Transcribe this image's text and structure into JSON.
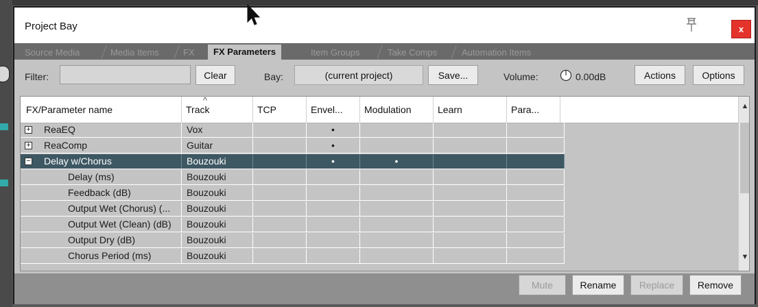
{
  "window": {
    "title": "Project Bay",
    "close_label": "x"
  },
  "tabs": [
    {
      "label": "Source Media",
      "active": false
    },
    {
      "label": "Media Items",
      "active": false
    },
    {
      "label": "FX",
      "active": false
    },
    {
      "label": "FX Parameters",
      "active": true
    },
    {
      "label": "Item Groups",
      "active": false
    },
    {
      "label": "Take Comps",
      "active": false
    },
    {
      "label": "Automation Items",
      "active": false
    }
  ],
  "toolbar": {
    "filter_label": "Filter:",
    "filter_value": "",
    "clear_label": "Clear",
    "bay_label": "Bay:",
    "bay_value": "(current project)",
    "save_label": "Save...",
    "volume_label": "Volume:",
    "volume_value": "0.00dB",
    "actions_label": "Actions",
    "options_label": "Options"
  },
  "table": {
    "columns": [
      "FX/Parameter name",
      "Track",
      "TCP",
      "Envel...",
      "Modulation",
      "Learn",
      "Para..."
    ],
    "rows": [
      {
        "name": "ReaEQ",
        "track": "Vox",
        "tcp": "",
        "envelope": "•",
        "modulation": "",
        "learn": "",
        "param": "",
        "expander": "+",
        "selected": false,
        "indent": false
      },
      {
        "name": "ReaComp",
        "track": "Guitar",
        "tcp": "",
        "envelope": "•",
        "modulation": "",
        "learn": "",
        "param": "",
        "expander": "+",
        "selected": false,
        "indent": false
      },
      {
        "name": "Delay w/Chorus",
        "track": "Bouzouki",
        "tcp": "",
        "envelope": "•",
        "modulation": "•",
        "learn": "",
        "param": "",
        "expander": "−",
        "selected": true,
        "indent": false
      },
      {
        "name": "Delay (ms)",
        "track": "Bouzouki",
        "tcp": "",
        "envelope": "",
        "modulation": "",
        "learn": "",
        "param": "",
        "expander": "",
        "selected": false,
        "indent": true
      },
      {
        "name": "Feedback (dB)",
        "track": "Bouzouki",
        "tcp": "",
        "envelope": "",
        "modulation": "",
        "learn": "",
        "param": "",
        "expander": "",
        "selected": false,
        "indent": true
      },
      {
        "name": "Output Wet (Chorus) (...",
        "track": "Bouzouki",
        "tcp": "",
        "envelope": "",
        "modulation": "",
        "learn": "",
        "param": "",
        "expander": "",
        "selected": false,
        "indent": true
      },
      {
        "name": "Output Wet (Clean) (dB)",
        "track": "Bouzouki",
        "tcp": "",
        "envelope": "",
        "modulation": "",
        "learn": "",
        "param": "",
        "expander": "",
        "selected": false,
        "indent": true
      },
      {
        "name": "Output Dry (dB)",
        "track": "Bouzouki",
        "tcp": "",
        "envelope": "",
        "modulation": "",
        "learn": "",
        "param": "",
        "expander": "",
        "selected": false,
        "indent": true
      },
      {
        "name": "Chorus Period (ms)",
        "track": "Bouzouki",
        "tcp": "",
        "envelope": "",
        "modulation": "",
        "learn": "",
        "param": "",
        "expander": "",
        "selected": false,
        "indent": true
      }
    ]
  },
  "footer": {
    "mute_label": "Mute",
    "rename_label": "Rename",
    "replace_label": "Replace",
    "remove_label": "Remove"
  },
  "colors": {
    "selection": "#3e5863",
    "close_button": "#e3332b",
    "panel": "#c4c4c4"
  }
}
